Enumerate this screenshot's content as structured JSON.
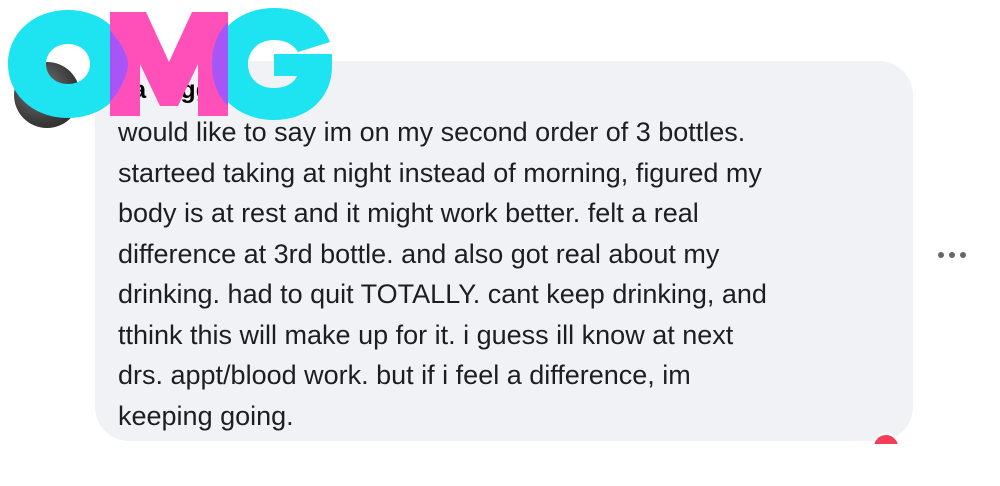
{
  "sticker": {
    "letters": [
      "O",
      "M",
      "G"
    ],
    "colors": {
      "o": "#1ee3f0",
      "m": "#ff4fb8",
      "g": "#1ee3f0",
      "overlap": "#a855f7"
    }
  },
  "comment": {
    "author": "l      a        wiggins",
    "lines": [
      "would like to say im on my second order of 3 bottles.",
      "starteed taking at night instead of morning, figured my",
      "body is at rest and it might work better. felt a real",
      "difference at 3rd bottle. and also got real about my",
      "drinking. had to quit TOTALLY. cant keep drinking, and",
      "tthink this will make up for it. i guess ill know at next",
      "drs. appt/blood work. but if i feel a difference, im",
      "keeping going."
    ],
    "bubble_color": "#f0f2f5",
    "text_color": "#1c1e21"
  },
  "actions": {
    "more_icon": "more-horizontal-icon"
  }
}
